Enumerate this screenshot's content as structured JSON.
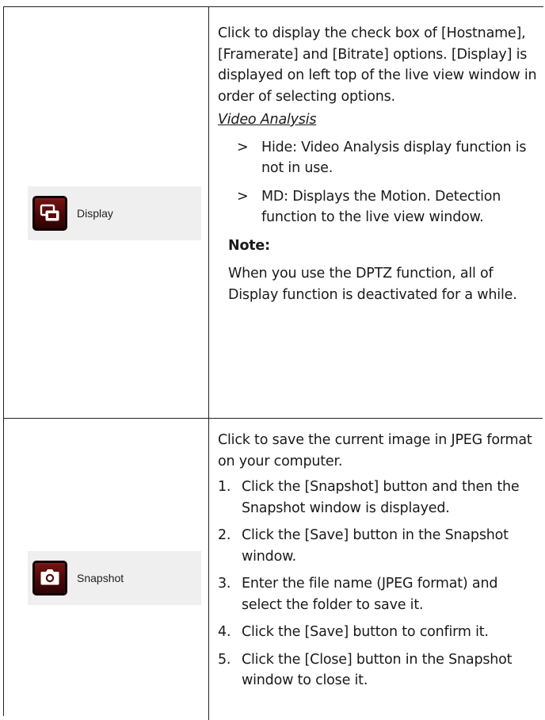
{
  "rows": {
    "display": {
      "button_label": "Display",
      "button_icon": "display-overlay-icon",
      "intro": "Click to display the check box of [Hostname], [Framerate] and [Bitrate] options. [Display] is displayed on left top of the live view window in order of selecting options.",
      "subheading": "Video Analysis",
      "bullets": [
        {
          "marker": ">",
          "text": "Hide: Video Analysis display function is not in use."
        },
        {
          "marker": ">",
          "text": "MD: Displays the Motion. Detection function to the live view window."
        }
      ],
      "note_title": "Note:",
      "note_body": "When you use the DPTZ function, all of Display function is deactivated for a while."
    },
    "snapshot": {
      "button_label": "Snapshot",
      "button_icon": "camera-icon",
      "intro": "Click to save the current image in JPEG format on your computer.",
      "steps": [
        {
          "num": "1.",
          "text": "Click the [Snapshot] button and then the Snapshot window is displayed."
        },
        {
          "num": "2.",
          "text": "Click the [Save] button in the Snapshot window."
        },
        {
          "num": "3.",
          "text": "Enter the file name (JPEG format) and select the folder to save it."
        },
        {
          "num": "4.",
          "text": "Click the [Save] button to confirm it."
        },
        {
          "num": "5.",
          "text": "Click the [Close] button in the Snapshot window to close it."
        }
      ]
    }
  },
  "colors": {
    "button_bg_top": "#7a1515",
    "button_bg_bottom": "#2a0303",
    "panel_bg": "#efefef",
    "border": "#222222"
  }
}
